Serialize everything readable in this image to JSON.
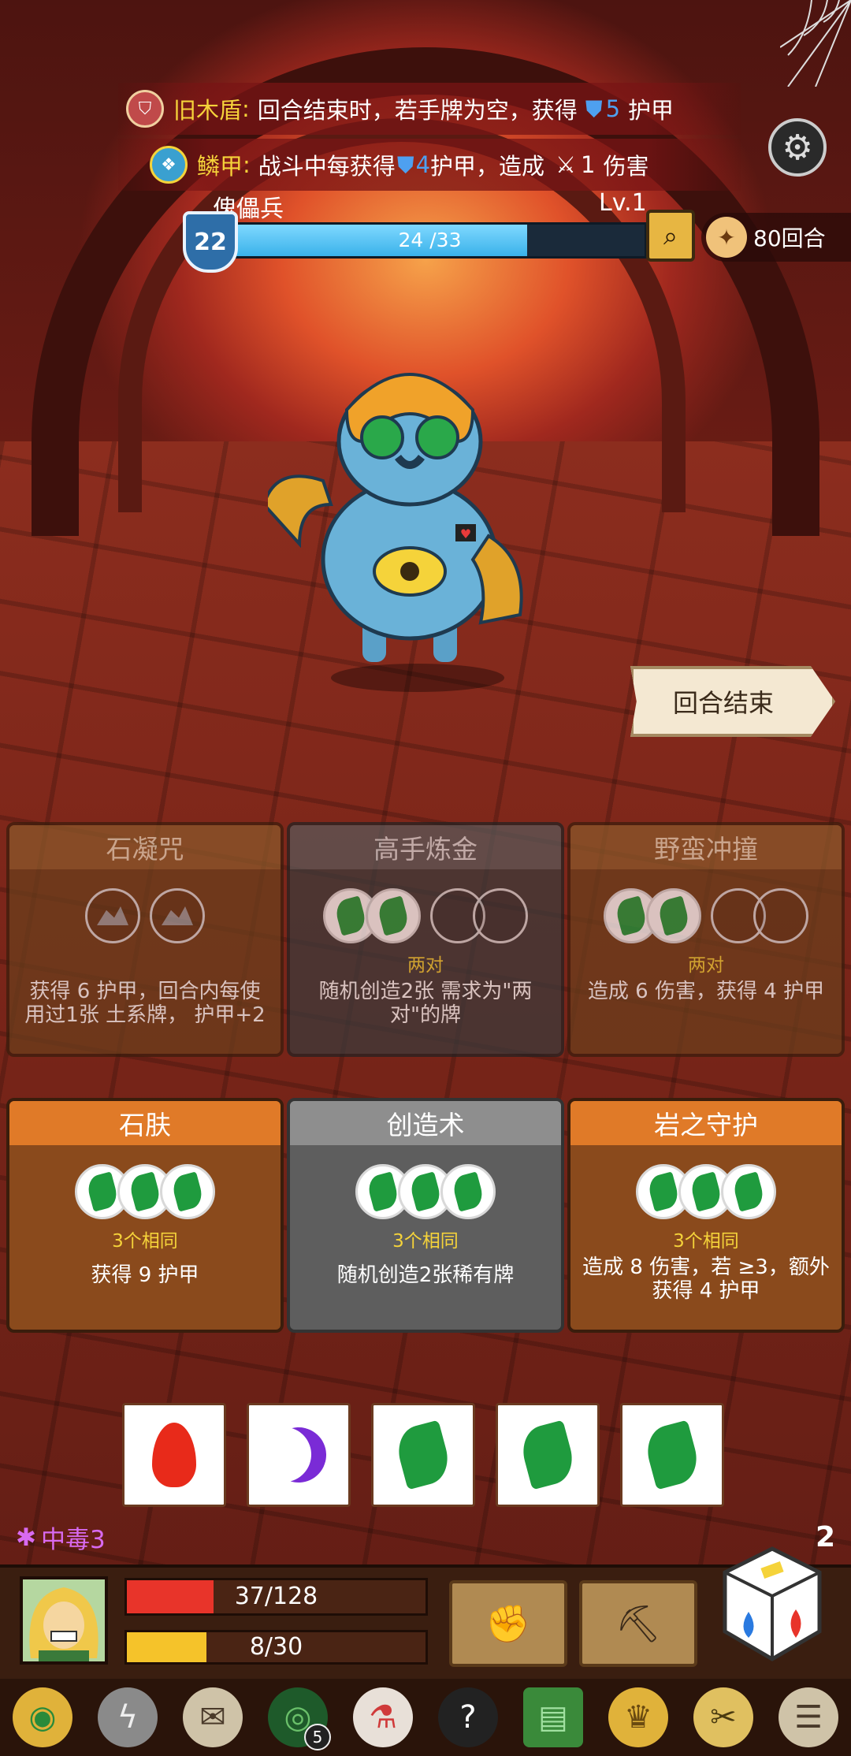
{
  "buffs": [
    {
      "name": "旧木盾",
      "sep": ":",
      "desc": "回合结束时，若手牌为空，获得",
      "value": "5",
      "unit": "护甲",
      "icon": "wood-shield-icon"
    },
    {
      "name": "鳞甲",
      "sep": ":",
      "desc_a": "战斗中每获得",
      "value_a": "4",
      "unit_a": "护甲，造成",
      "value_b": "1",
      "unit_b": "伤害",
      "icon": "scale-armor-icon"
    }
  ],
  "enemy": {
    "name": "傀儡兵",
    "level": "Lv.1",
    "hp_text": "24 /33",
    "hp": 24,
    "hp_max": 33,
    "armor": "22"
  },
  "rounds": "80回合",
  "end_turn_label": "回合结束",
  "cards": [
    {
      "title": "石凝咒",
      "req": "",
      "desc": "获得 6 护甲，回合内每使用过1张 土系牌，  护甲+2",
      "style": "brown dim"
    },
    {
      "title": "高手炼金",
      "req": "两对",
      "desc": "随机创造2张 需求为\"两对\"的牌",
      "style": "gray dim"
    },
    {
      "title": "野蛮冲撞",
      "req": "两对",
      "desc": "造成 6 伤害，获得 4 护甲",
      "style": "brown dim"
    },
    {
      "title": "石肤",
      "req": "3个相同",
      "desc": "获得 9 护甲",
      "style": "orange"
    },
    {
      "title": "创造术",
      "req": "3个相同",
      "desc": "随机创造2张稀有牌",
      "style": "gray2"
    },
    {
      "title": "岩之守护",
      "req": "3个相同",
      "desc": "造成 8 伤害，若 ≥3，额外获得 4 护甲",
      "style": "orange"
    }
  ],
  "dice": [
    "fire",
    "moon",
    "leaf",
    "leaf",
    "leaf"
  ],
  "status": "中毒3",
  "player": {
    "hp_text": "37/128",
    "hp": 37,
    "hp_max": 128,
    "energy_text": "8/30",
    "energy": 8,
    "energy_max": 30
  },
  "reroll_count": "2",
  "toolbar": [
    {
      "name": "relic-ring-icon",
      "glyph": "◉",
      "badge": ""
    },
    {
      "name": "lightning-orb-icon",
      "glyph": "ϟ",
      "badge": ""
    },
    {
      "name": "scroll-icon",
      "glyph": "✉",
      "badge": ""
    },
    {
      "name": "wreath-icon",
      "glyph": "◎",
      "badge": "5"
    },
    {
      "name": "potion-jar-icon",
      "glyph": "⚗",
      "badge": ""
    },
    {
      "name": "mystery-hat-icon",
      "glyph": "?",
      "badge": ""
    },
    {
      "name": "spellbook-icon",
      "glyph": "▤",
      "badge": ""
    },
    {
      "name": "helmet-icon",
      "glyph": "♛",
      "badge": ""
    },
    {
      "name": "claw-icon",
      "glyph": "✂",
      "badge": ""
    },
    {
      "name": "map-scroll-icon",
      "glyph": "☰",
      "badge": ""
    }
  ],
  "colors": {
    "hp": "#e8342a",
    "energy": "#f5c32a",
    "poison": "#d86af0",
    "armor": "#3a8ad8"
  }
}
